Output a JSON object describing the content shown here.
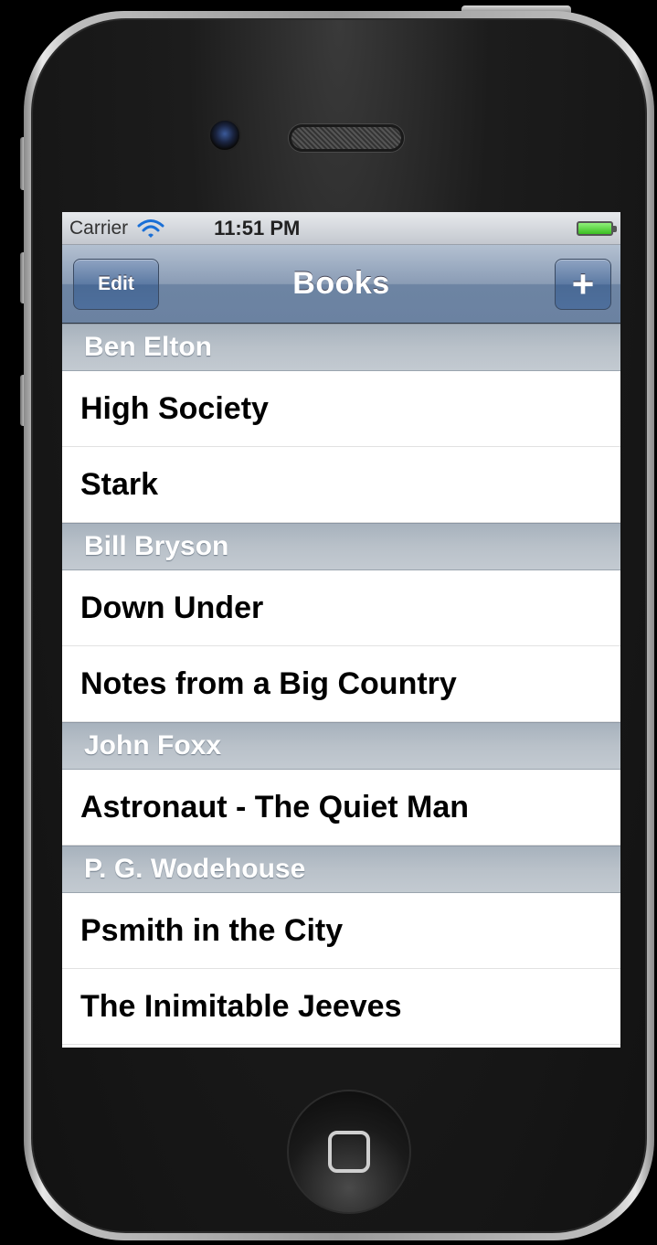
{
  "status_bar": {
    "carrier": "Carrier",
    "time": "11:51 PM"
  },
  "nav": {
    "title": "Books",
    "edit_label": "Edit",
    "add_label": "+"
  },
  "sections": [
    {
      "header": "Ben Elton",
      "rows": [
        "High Society",
        "Stark"
      ]
    },
    {
      "header": "Bill Bryson",
      "rows": [
        "Down Under",
        "Notes from a Big Country"
      ]
    },
    {
      "header": "John Foxx",
      "rows": [
        "Astronaut - The Quiet Man"
      ]
    },
    {
      "header": "P. G. Wodehouse",
      "rows": [
        "Psmith in the City",
        "The Inimitable Jeeves"
      ]
    }
  ],
  "colors": {
    "nav_bar": "#6d84a3",
    "section_header": "#b3bcc6"
  },
  "icons": [
    "wifi-icon",
    "battery-icon",
    "plus-icon",
    "home-button-icon"
  ]
}
